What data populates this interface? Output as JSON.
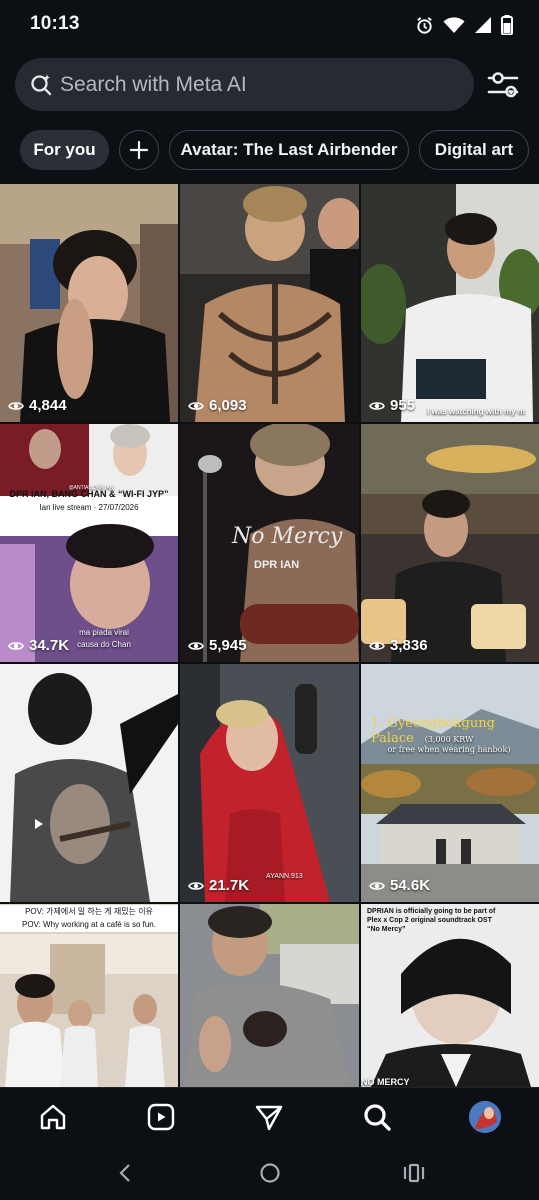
{
  "status_bar": {
    "time": "10:13",
    "icons": [
      "alarm-icon",
      "wifi-icon",
      "cellular-signal-icon",
      "battery-icon"
    ]
  },
  "search": {
    "placeholder": "Search with Meta AI"
  },
  "chips": [
    {
      "label": "For you",
      "active": true
    },
    {
      "label": "+",
      "icon": "plus-icon"
    },
    {
      "label": "Avatar: The Last Airbender"
    },
    {
      "label": "Digital art"
    }
  ],
  "tiles": [
    {
      "views": "4,844"
    },
    {
      "views": "6,093"
    },
    {
      "views": "955",
      "caption": "i was watching with my m"
    },
    {
      "views": "34.7K",
      "caption_top": "DPR IAN, BANG CHAN & “WI-FI JYP”",
      "caption_sub": "Ian live stream · 27/07/2026",
      "caption_side": "ma piada viral causa do Chan",
      "watermark": "@ANTIAB.DPR.IAN"
    },
    {
      "views": "5,945",
      "title": "No Mercy",
      "subtitle": "DPR IAN"
    },
    {
      "views": "3,836"
    },
    {
      "views": ""
    },
    {
      "views": "21.7K",
      "watermark": "AYANN.913"
    },
    {
      "views": "54.6K",
      "title": "1. Gyeongbokgung Palace",
      "subtitle": "(3,000 KRW",
      "subtitle2": "or free when wearing hanbok)"
    },
    {
      "views": "",
      "caption_top": "POV: 가제에서 일 하는 게 재밌는 이유",
      "caption_sub": "POV: Why working at a café is so fun."
    },
    {
      "views": ""
    },
    {
      "views": "",
      "caption_top": "DPRIAN is officially going to be part of Plex x Cop 2 original soundtrack OST “No Mercy”",
      "footer": "NO MERCY"
    }
  ],
  "bottom_nav": [
    "home-icon",
    "reels-icon",
    "send-icon",
    "search-icon",
    "profile-avatar"
  ],
  "system_nav": [
    "back-icon",
    "home-circle-icon",
    "recents-icon"
  ],
  "colors": {
    "background": "#0c0f14",
    "search_bg": "#272a31",
    "chip_active_bg": "#2b2f37"
  }
}
